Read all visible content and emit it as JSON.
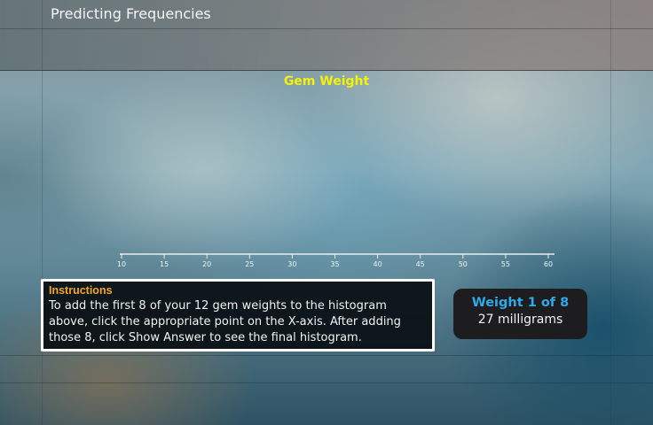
{
  "app": {
    "title": "Predicting Frequencies"
  },
  "histogram": {
    "title": "Gem Weight",
    "ticks": [
      "10",
      "15",
      "20",
      "25",
      "30",
      "35",
      "40",
      "45",
      "50",
      "55",
      "60"
    ]
  },
  "instructions": {
    "heading": "Instructions",
    "body": "To add the first 8 of your 12 gem weights to the histogram above, click the appropriate point on the X-axis. After adding those 8, click Show Answer to see the final histogram."
  },
  "weight_panel": {
    "label": "Weight 1 of 8",
    "value": "27 milligrams"
  },
  "colors": {
    "title_yellow": "#f4f20a",
    "heading_orange": "#f5a623",
    "weight_blue": "#2fa9e8"
  }
}
